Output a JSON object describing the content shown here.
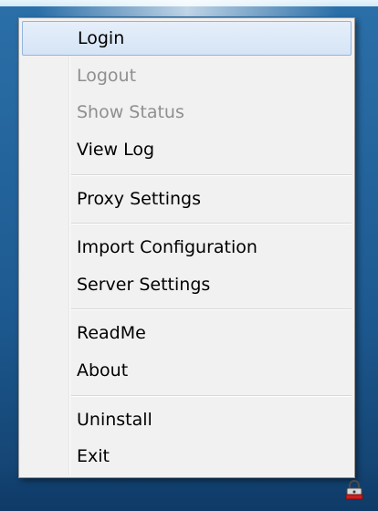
{
  "menu": {
    "items": [
      {
        "label": "Login",
        "state": "highlighted"
      },
      {
        "label": "Logout",
        "state": "disabled"
      },
      {
        "label": "Show Status",
        "state": "disabled"
      },
      {
        "label": "View Log",
        "state": "normal"
      },
      {
        "label": "Proxy Settings",
        "state": "normal"
      },
      {
        "label": "Import Configuration",
        "state": "normal"
      },
      {
        "label": "Server Settings",
        "state": "normal"
      },
      {
        "label": "ReadMe",
        "state": "normal"
      },
      {
        "label": "About",
        "state": "normal"
      },
      {
        "label": "Uninstall",
        "state": "normal"
      },
      {
        "label": "Exit",
        "state": "normal"
      }
    ]
  },
  "tray": {
    "icon": "lock-icon",
    "accent_color": "#cc1f1f"
  },
  "colors": {
    "menu_background": "#f1f1f1",
    "highlight_background": "#d9e7f7",
    "highlight_border": "#92b4de",
    "disabled_text": "#8f8f8f"
  }
}
